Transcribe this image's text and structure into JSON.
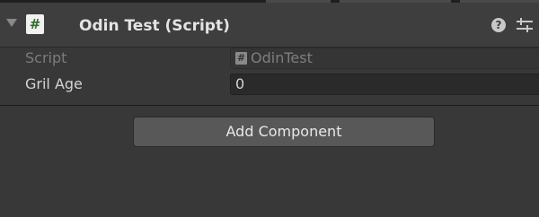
{
  "component": {
    "title": "Odin Test (Script)",
    "script_icon_glyph": "#",
    "help_icon_glyph": "?"
  },
  "rows": [
    {
      "label": "Script",
      "value": "OdinTest",
      "value_icon_glyph": "#",
      "enabled": false
    },
    {
      "label": "Gril Age",
      "value": "0",
      "enabled": true
    }
  ],
  "add_component": {
    "label": "Add Component"
  },
  "icons": {
    "foldout": "triangle-down-icon",
    "script": "csharp-script-icon",
    "help": "help-icon",
    "presets": "sliders-icon"
  },
  "colors": {
    "background": "#383838",
    "header": "#3e3e3e",
    "field": "#2a2a2a",
    "button": "#585858",
    "script_icon_fg": "#2f6f2f"
  }
}
